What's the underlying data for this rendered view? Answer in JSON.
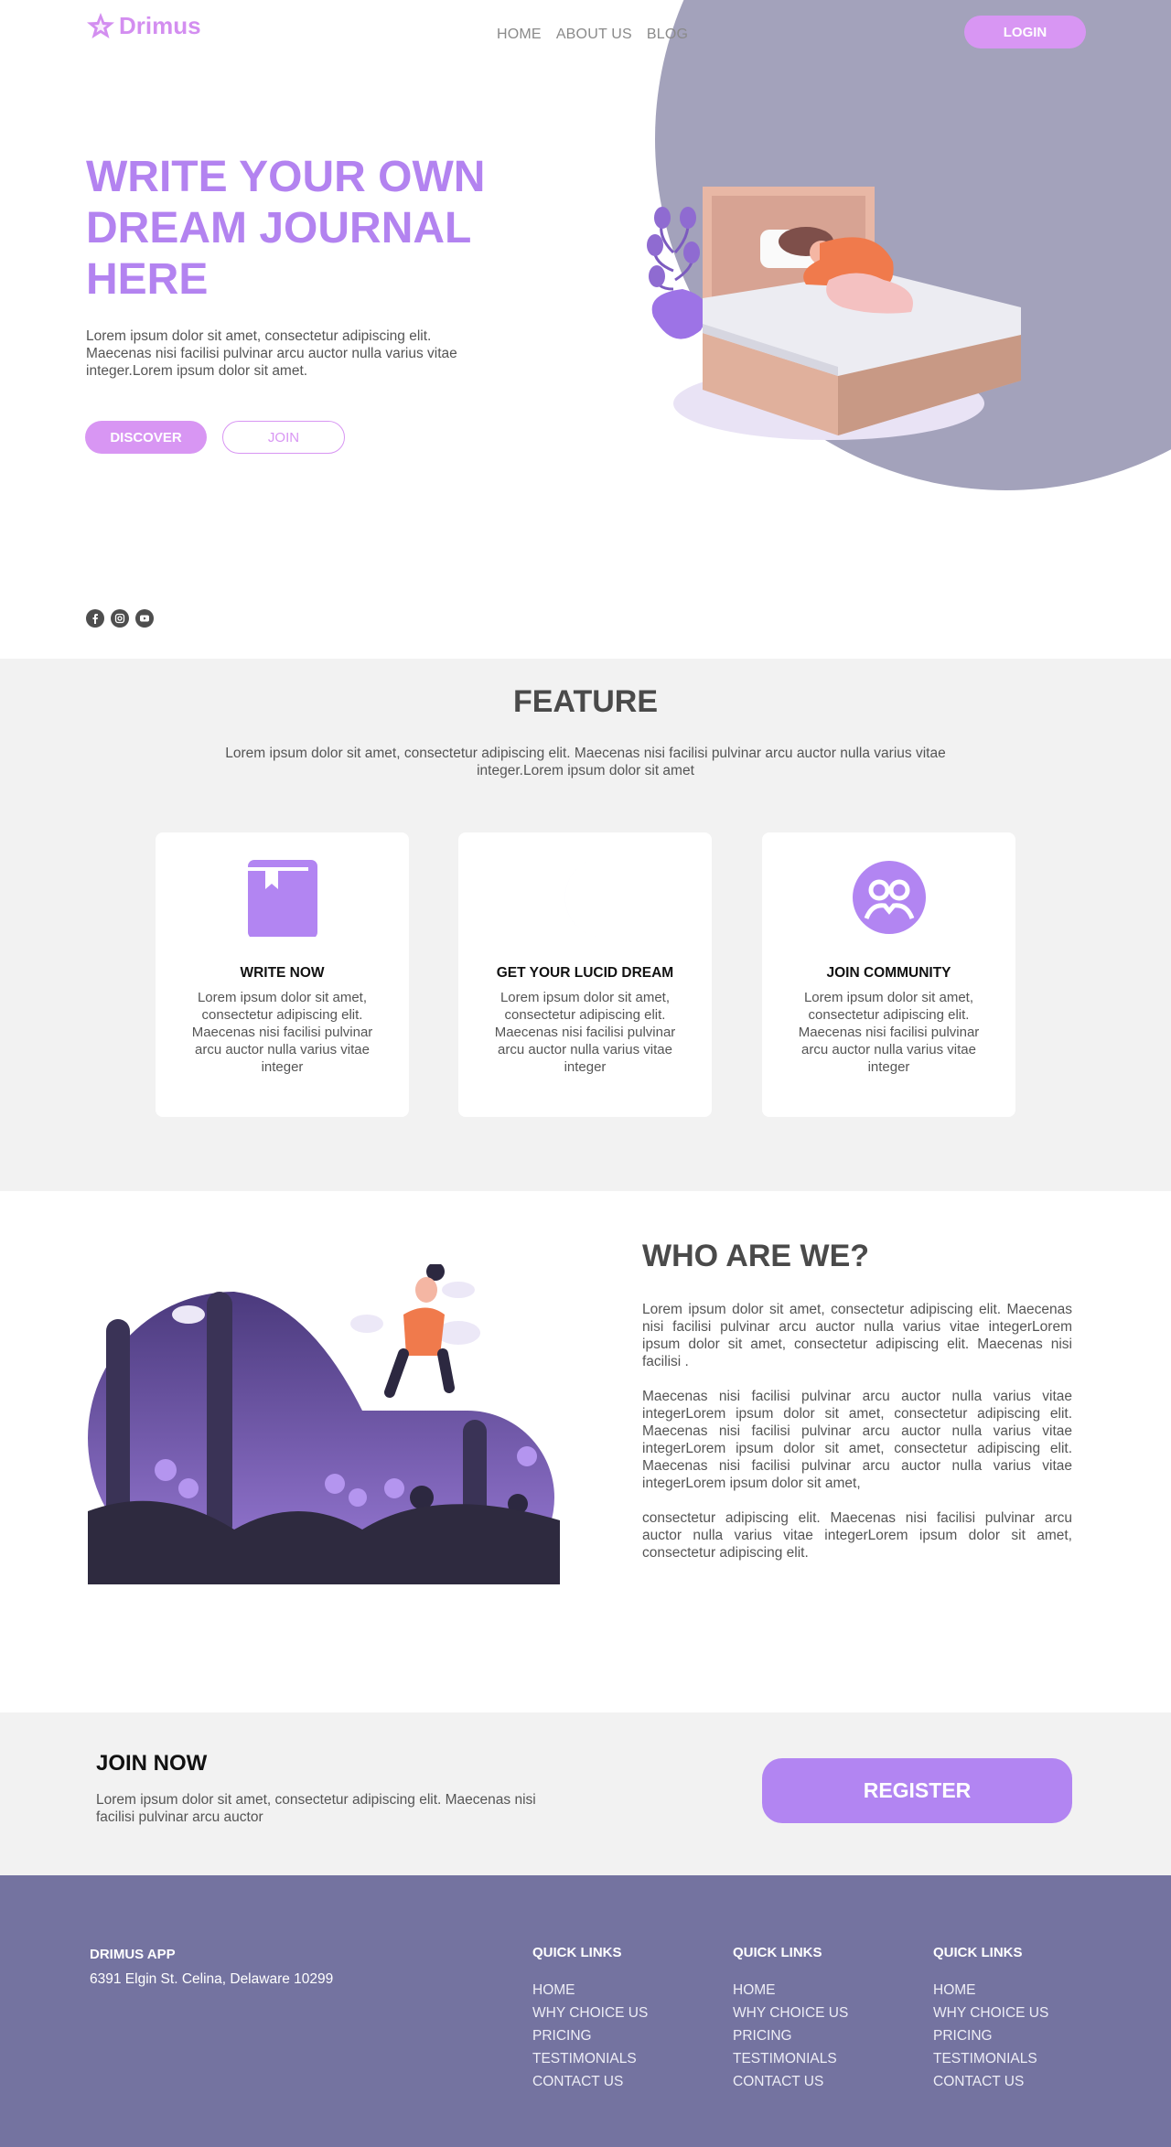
{
  "brand": {
    "name": "Drimus",
    "logo_icon": "star-icon",
    "accent": "#d38ef0"
  },
  "nav": {
    "items": [
      "HOME",
      "ABOUT US",
      "BLOG"
    ],
    "login_label": "LOGIN"
  },
  "hero": {
    "title": "WRITE YOUR OWN DREAM JOURNAL HERE",
    "description": "Lorem ipsum dolor sit amet, consectetur adipiscing elit. Maecenas nisi facilisi pulvinar arcu auctor nulla varius vitae integer.Lorem ipsum dolor sit amet.",
    "discover_label": "DISCOVER",
    "join_label": "JOIN",
    "circle_color": "#a3a2bb",
    "socials": [
      "facebook-icon",
      "instagram-icon",
      "youtube-icon"
    ]
  },
  "feature": {
    "title": "FEATURE",
    "description": "Lorem ipsum dolor sit amet, consectetur adipiscing elit. Maecenas nisi facilisi pulvinar arcu auctor nulla varius vitae integer.Lorem ipsum dolor sit amet",
    "cards": [
      {
        "icon": "book-icon",
        "title": "WRITE NOW",
        "text": "Lorem ipsum dolor sit amet, consectetur adipiscing elit. Maecenas nisi facilisi pulvinar arcu auctor nulla varius vitae integer"
      },
      {
        "icon": "moon-icon",
        "title": "GET YOUR LUCID DREAM",
        "text": "Lorem ipsum dolor sit amet, consectetur adipiscing elit. Maecenas nisi facilisi pulvinar arcu auctor nulla varius vitae integer"
      },
      {
        "icon": "community-icon",
        "title": "JOIN COMMUNITY",
        "text": "Lorem ipsum dolor sit amet, consectetur adipiscing elit. Maecenas nisi facilisi pulvinar arcu auctor nulla varius vitae integer"
      }
    ],
    "icon_color": "#b285f2"
  },
  "who": {
    "title": "WHO ARE WE?",
    "paragraphs": [
      "Lorem ipsum dolor sit amet, consectetur adipiscing elit. Maecenas nisi facilisi pulvinar arcu auctor nulla varius vitae integerLorem ipsum dolor sit amet, consectetur adipiscing elit. Maecenas nisi facilisi .",
      "Maecenas nisi facilisi pulvinar arcu auctor nulla varius vitae integerLorem ipsum dolor sit amet, consectetur adipiscing elit. Maecenas nisi facilisi pulvinar arcu auctor nulla varius vitae integerLorem ipsum dolor sit amet, consectetur adipiscing elit. Maecenas nisi facilisi pulvinar arcu auctor nulla varius vitae integerLorem ipsum dolor sit amet,",
      "consectetur adipiscing elit. Maecenas nisi facilisi pulvinar arcu auctor nulla varius vitae integerLorem ipsum dolor sit amet, consectetur adipiscing elit."
    ]
  },
  "join": {
    "title": "JOIN NOW",
    "description": "Lorem ipsum dolor sit amet, consectetur adipiscing elit. Maecenas nisi facilisi pulvinar arcu auctor",
    "register_label": "REGISTER"
  },
  "footer": {
    "brand": "DRIMUS APP",
    "address": "6391 Elgin St. Celina, Delaware 10299",
    "background": "#7473a0",
    "columns": [
      {
        "title": "QUICK LINKS",
        "links": [
          "HOME",
          "WHY CHOICE US",
          "PRICING",
          "TESTIMONIALS",
          "CONTACT US"
        ]
      },
      {
        "title": "QUICK LINKS",
        "links": [
          "HOME",
          "WHY CHOICE US",
          "PRICING",
          "TESTIMONIALS",
          "CONTACT US"
        ]
      },
      {
        "title": "QUICK LINKS",
        "links": [
          "HOME",
          "WHY CHOICE US",
          "PRICING",
          "TESTIMONIALS",
          "CONTACT US"
        ]
      }
    ]
  }
}
